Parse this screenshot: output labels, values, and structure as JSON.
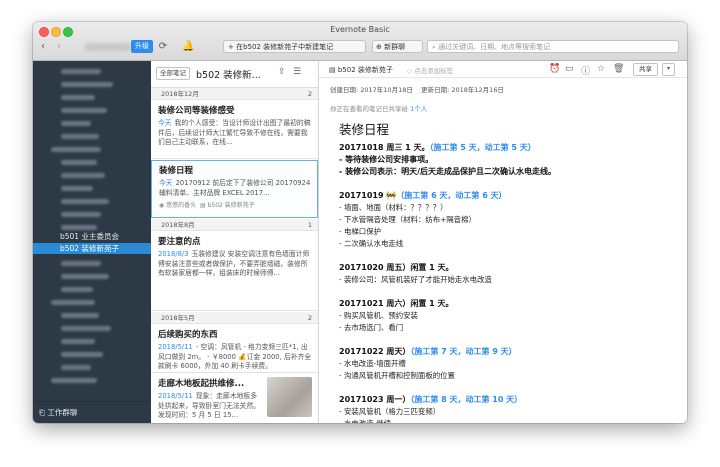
{
  "window": {
    "title": "Evernote Basic"
  },
  "toolbar": {
    "upgrade_label": "升级",
    "create_note_label": "在b502 装修新苑子中新建笔记",
    "work_chat_label": "新群聊",
    "search_placeholder": "通过关键词、日期、地点等搜索笔记"
  },
  "sidebar": {
    "notebooks": [
      {
        "label": "b501 业主委员会"
      },
      {
        "label": "b502 装修新苑子"
      }
    ],
    "footer_label": "工作群聊"
  },
  "notelist": {
    "all_notes_label": "全部笔记",
    "notebook_title": "b502 装修新...",
    "groups": [
      {
        "month": "2018年12月",
        "count": "2"
      },
      {
        "month": "2018年8月",
        "count": "1"
      },
      {
        "month": "2018年5月",
        "count": "2"
      }
    ],
    "notes": [
      {
        "title": "装修公司等装修感受",
        "date": "今天",
        "snippet": "我的个人感受：当设计师设计出图了最初的稿件后，后续设计师大江繁忙导致不修在线，需要我们自己主动联系，在线..."
      },
      {
        "title": "装修日程",
        "date": "今天",
        "snippet": "20170912 前后定下了装修公司 20170924 辅料清单、主材品牌 EXCEL 2017...",
        "meta_author": "悠悠的香头",
        "meta_notebook": "b502 装修新苑子"
      },
      {
        "title": "要注意的点",
        "date": "2018/8/3",
        "snippet": "玉装修建议 安装空调注意有色墙面计师傅安装注意些或者做保护，不要弄脏墙磁。装修所有软装家居都一样，组装床的时候师傅..."
      },
      {
        "title": "后续购买的东西",
        "date": "2018/5/11",
        "snippet": "- 空调：风管机 - 格力变频三匹*1, 出风口做到 2m。 - ￥8000 💰订金 2000, 后补齐全款刷卡 6000，外加 40 刷卡手续费。"
      },
      {
        "title": "走廊木地板起拱维修...",
        "date": "2018/5/11",
        "snippet": "现象：走廊木地板多处拱起来，导致卧室门无法关然。发现时间：5 月 5 日 15..."
      }
    ]
  },
  "editor": {
    "notebook_label": "b502 装修新苑子",
    "tag_placeholder": "点击添加标签",
    "created_label": "创建日期: 2017年10月18日",
    "updated_label": "更新日期: 2018年12月16日",
    "shared_prefix": "你正在查看的笔记已共享给",
    "shared_count": "1个人",
    "share_label": "共享",
    "title": "装修日程",
    "lines": [
      {
        "text": "20171018 周三 1 天。",
        "highlight": "（施工第 5 天，动工第 5 天）",
        "bold": true
      },
      {
        "text": "- 等待装修公司安排事项。",
        "bold": true
      },
      {
        "text": "- 装修公司表示：明天/后天走成品保护且二次确认水电走线。",
        "bold": true
      },
      {
        "gap": true
      },
      {
        "text": "20171019 🚧",
        "highlight": "（施工第 6 天，动工第 6 天）",
        "bold": true
      },
      {
        "text": "- 墙面、地面（材料：？？？？）"
      },
      {
        "text": "- 下水管隔音处理（材料：纺布+隔音棉）"
      },
      {
        "text": "- 电梯口保护"
      },
      {
        "text": "- 二次确认水电走线"
      },
      {
        "gap": true
      },
      {
        "text": "20171020 周五）闲置 1 天。",
        "bold": true
      },
      {
        "text": "- 装修公司：风管机装好了才能开始走水电改造"
      },
      {
        "gap": true
      },
      {
        "text": "20171021 周六）闲置 1 天。",
        "bold": true
      },
      {
        "text": "- 购买风管机、预约安装"
      },
      {
        "text": "- 去市场选门、看门"
      },
      {
        "gap": true
      },
      {
        "text": "20171022 周天）",
        "highlight": "（施工第 7 天，动工第 9 天）",
        "bold": true
      },
      {
        "text": "- 水电改造-墙面开槽"
      },
      {
        "text": "- 沟通风管机开槽和控制面板的位置"
      },
      {
        "gap": true
      },
      {
        "text": "20171023 周一）",
        "highlight": "（施工第 8 天，动工第 10 天）",
        "bold": true
      },
      {
        "text": "- 安装风管机（格力三匹变频）"
      },
      {
        "text": "- 水电改造-继续"
      }
    ]
  }
}
